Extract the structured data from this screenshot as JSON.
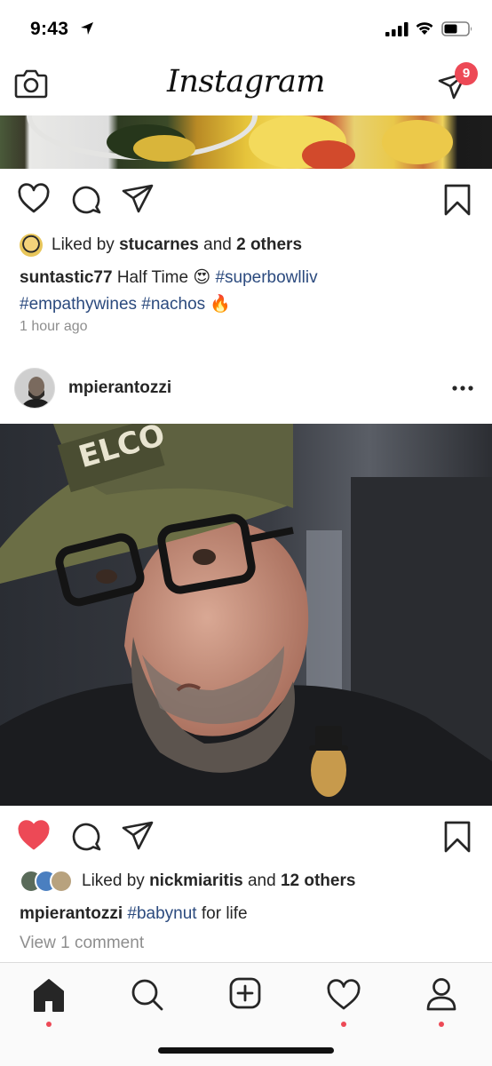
{
  "status_bar": {
    "time": "9:43"
  },
  "header": {
    "logo": "Instagram",
    "dm_badge_count": "9"
  },
  "post1": {
    "liked_prefix": "Liked by",
    "liked_user": "stucarnes",
    "liked_and": "and",
    "liked_others": "2 others",
    "caption_user": "suntastic77",
    "caption_text": "Half Time",
    "caption_emoji": "😍",
    "hashtags_line1": "#superbowlliv",
    "hashtags_line2": "#empathywines #nachos",
    "caption_emoji2": "🔥",
    "timestamp": "1 hour ago"
  },
  "post2": {
    "username": "mpierantozzi",
    "liked": true,
    "liked_prefix": "Liked by",
    "liked_user": "nickmiaritis",
    "liked_and": "and",
    "liked_others": "12 others",
    "caption_user": "mpierantozzi",
    "caption_tag": "#babynut",
    "caption_text": "for life",
    "view_comments": "View 1 comment"
  },
  "colors": {
    "like_red": "#ed4956",
    "hashtag_blue": "#2b4a7e",
    "muted_gray": "#8e8e8e"
  },
  "tabs": [
    {
      "name": "home",
      "icon": "home-icon",
      "active": true,
      "dot": true
    },
    {
      "name": "search",
      "icon": "search-icon",
      "active": false,
      "dot": false
    },
    {
      "name": "new-post",
      "icon": "add-post-icon",
      "active": false,
      "dot": false
    },
    {
      "name": "activity",
      "icon": "heart-icon",
      "active": false,
      "dot": true
    },
    {
      "name": "profile",
      "icon": "profile-icon",
      "active": false,
      "dot": true
    }
  ]
}
